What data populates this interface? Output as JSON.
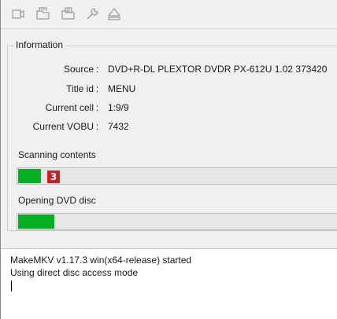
{
  "toolbar": {
    "buttons": [
      {
        "icon": "open-video-file-icon"
      },
      {
        "icon": "open-disc-folder-icon"
      },
      {
        "icon": "backup-disc-icon"
      },
      {
        "icon": "settings-wrench-icon"
      },
      {
        "icon": "eject-icon"
      }
    ]
  },
  "information": {
    "title": "Information",
    "rows": [
      {
        "label": "Source",
        "value": "DVD+R-DL PLEXTOR DVDR   PX-612U 1.02 373420"
      },
      {
        "label": "Title id",
        "value": "MENU"
      },
      {
        "label": "Current cell",
        "value": "1:9/9"
      },
      {
        "label": "Current VOBU",
        "value": "7432"
      }
    ],
    "separator": ":"
  },
  "progress": {
    "scanning": {
      "label": "Scanning contents",
      "level_percent": 7
    },
    "opening": {
      "label": "Opening DVD disc",
      "level_percent": 11
    }
  },
  "annotation_badge": "3",
  "log": {
    "lines": [
      "MakeMKV v1.17.3 win(x64-release) started",
      "Using direct disc access mode"
    ]
  },
  "colors": {
    "progress_fill": "#06b025",
    "badge": "#c8202a"
  }
}
